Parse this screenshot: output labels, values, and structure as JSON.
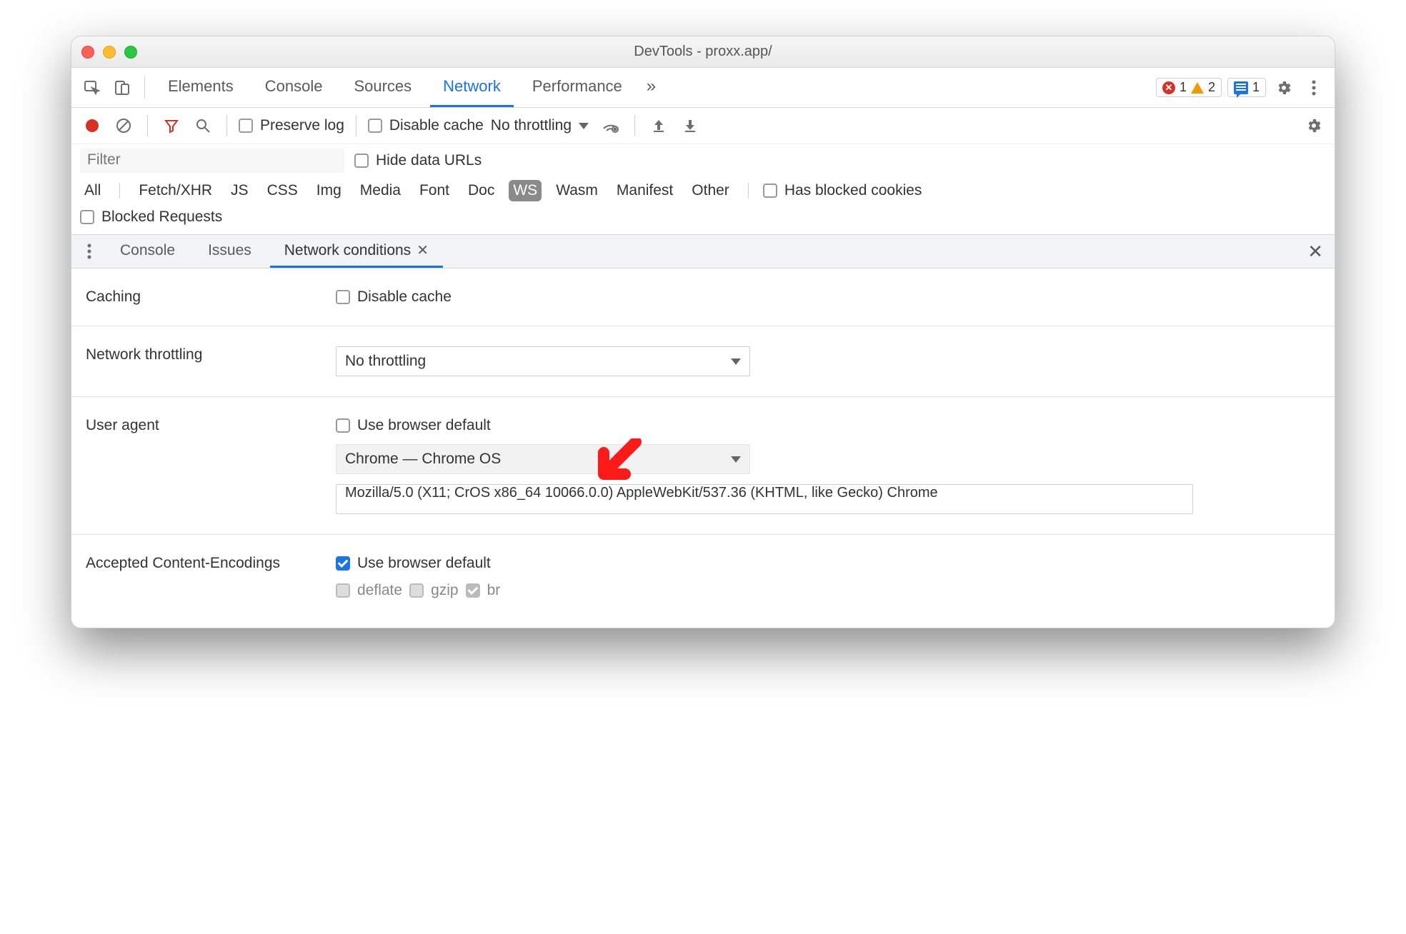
{
  "titlebar": {
    "title": "DevTools - proxx.app/"
  },
  "tabstrip": {
    "tabs": [
      "Elements",
      "Console",
      "Sources",
      "Network",
      "Performance"
    ],
    "active": "Network",
    "more": "»",
    "errors": "1",
    "warnings": "2",
    "messages": "1"
  },
  "nettoolbar": {
    "preserve": "Preserve log",
    "disable_cache": "Disable cache",
    "throttling": "No throttling"
  },
  "filter": {
    "placeholder": "Filter",
    "hide_urls": "Hide data URLs",
    "types": [
      "All",
      "Fetch/XHR",
      "JS",
      "CSS",
      "Img",
      "Media",
      "Font",
      "Doc",
      "WS",
      "Wasm",
      "Manifest",
      "Other"
    ],
    "selected_type": "WS",
    "blocked_cookies": "Has blocked cookies",
    "blocked_req": "Blocked Requests"
  },
  "drawer": {
    "tabs": [
      "Console",
      "Issues",
      "Network conditions"
    ],
    "active": "Network conditions"
  },
  "panel": {
    "caching": {
      "label": "Caching",
      "check": "Disable cache"
    },
    "throttling": {
      "label": "Network throttling",
      "value": "No throttling"
    },
    "ua": {
      "label": "User agent",
      "browser_default": "Use browser default",
      "select": "Chrome — Chrome OS",
      "value": "Mozilla/5.0 (X11; CrOS x86_64 10066.0.0) AppleWebKit/537.36 (KHTML, like Gecko) Chrome"
    },
    "enc": {
      "label": "Accepted Content-Encodings",
      "browser_default": "Use browser default",
      "opts": [
        "deflate",
        "gzip",
        "br"
      ]
    }
  }
}
